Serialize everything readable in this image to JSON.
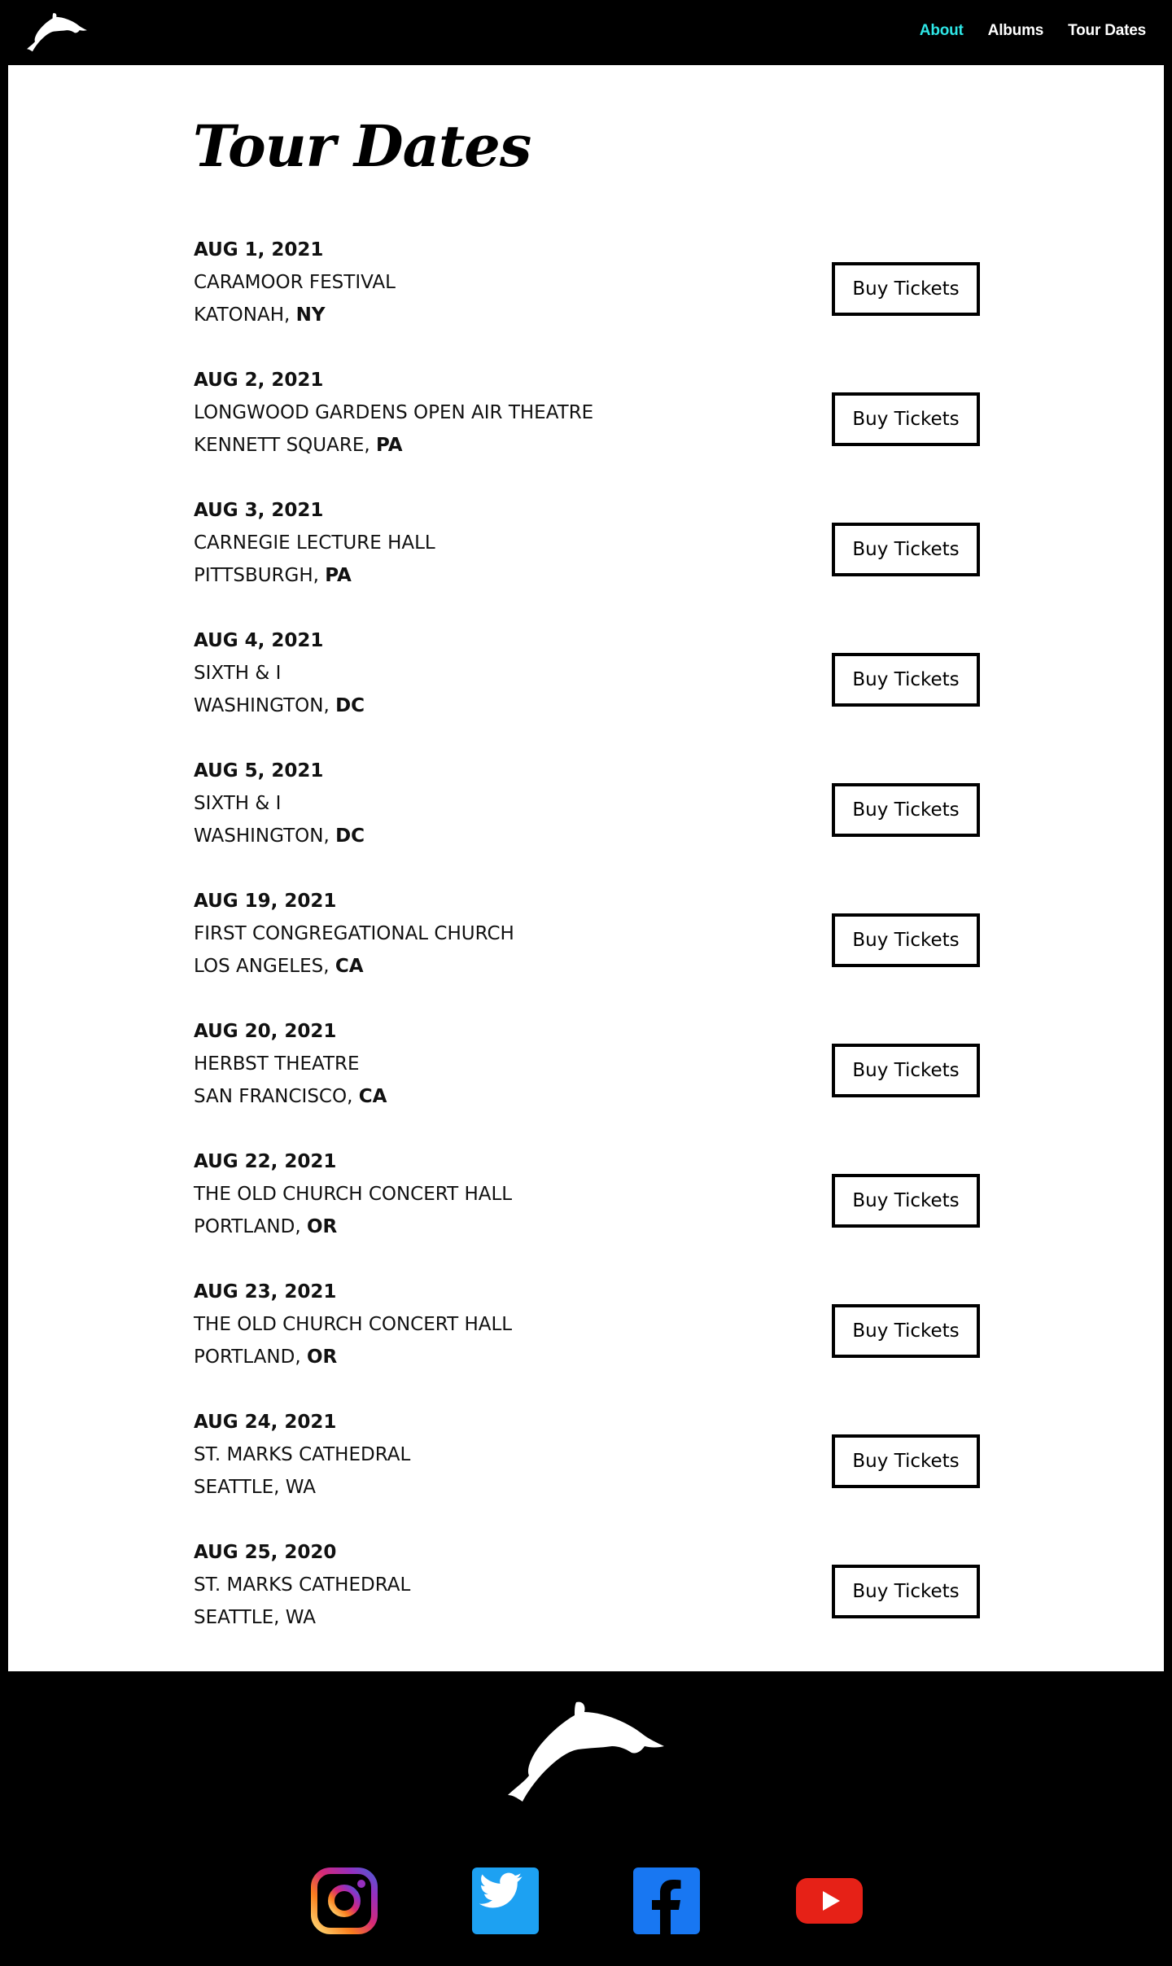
{
  "header": {
    "nav": [
      {
        "label": "About",
        "active": true
      },
      {
        "label": "Albums",
        "active": false
      },
      {
        "label": "Tour Dates",
        "active": false
      }
    ],
    "logo_icon": "dolphin-icon"
  },
  "page": {
    "title": "Tour Dates"
  },
  "shows": [
    {
      "date": "AUG 1, 2021",
      "venue": "CARAMOOR FESTIVAL",
      "city": "KATONAH, ",
      "state": "NY",
      "button": "Buy Tickets"
    },
    {
      "date": "AUG 2, 2021",
      "venue": "LONGWOOD GARDENS OPEN AIR THEATRE",
      "city": "KENNETT SQUARE, ",
      "state": "PA",
      "button": "Buy Tickets"
    },
    {
      "date": "AUG 3, 2021",
      "venue": "CARNEGIE LECTURE HALL",
      "city": "PITTSBURGH, ",
      "state": "PA",
      "button": "Buy Tickets"
    },
    {
      "date": "AUG 4, 2021",
      "venue": "SIXTH & I",
      "city": "WASHINGTON, ",
      "state": "DC",
      "button": "Buy Tickets"
    },
    {
      "date": "AUG 5, 2021",
      "venue": "SIXTH & I",
      "city": "WASHINGTON, ",
      "state": "DC",
      "button": "Buy Tickets"
    },
    {
      "date": "AUG 19, 2021",
      "venue": "FIRST CONGREGATIONAL CHURCH",
      "city": "LOS ANGELES, ",
      "state": "CA",
      "button": "Buy Tickets"
    },
    {
      "date": "AUG 20, 2021",
      "venue": "HERBST THEATRE",
      "city": "SAN FRANCISCO, ",
      "state": "CA",
      "button": "Buy Tickets"
    },
    {
      "date": "AUG 22, 2021",
      "venue": "THE OLD CHURCH CONCERT HALL",
      "city": "PORTLAND, ",
      "state": "OR",
      "button": "Buy Tickets"
    },
    {
      "date": "AUG 23, 2021",
      "venue": "THE OLD CHURCH CONCERT HALL",
      "city": "PORTLAND, ",
      "state": "OR",
      "button": "Buy Tickets"
    },
    {
      "date": "AUG 24, 2021",
      "venue": "ST. MARKS CATHEDRAL",
      "city": "SEATTLE, WA",
      "state": "",
      "button": "Buy Tickets"
    },
    {
      "date": "AUG 25, 2020",
      "venue": "ST. MARKS CATHEDRAL",
      "city": "SEATTLE, WA",
      "state": "",
      "button": "Buy Tickets"
    }
  ],
  "footer": {
    "logo_icon": "dolphin-icon",
    "socials": [
      {
        "icon": "instagram-icon"
      },
      {
        "icon": "twitter-icon"
      },
      {
        "icon": "facebook-icon"
      },
      {
        "icon": "youtube-icon"
      }
    ]
  },
  "colors": {
    "background": "#000000",
    "panel": "#ffffff",
    "nav_active": "#2ee6e6",
    "twitter": "#1da1f2",
    "facebook": "#1877f2",
    "youtube": "#e62117"
  }
}
